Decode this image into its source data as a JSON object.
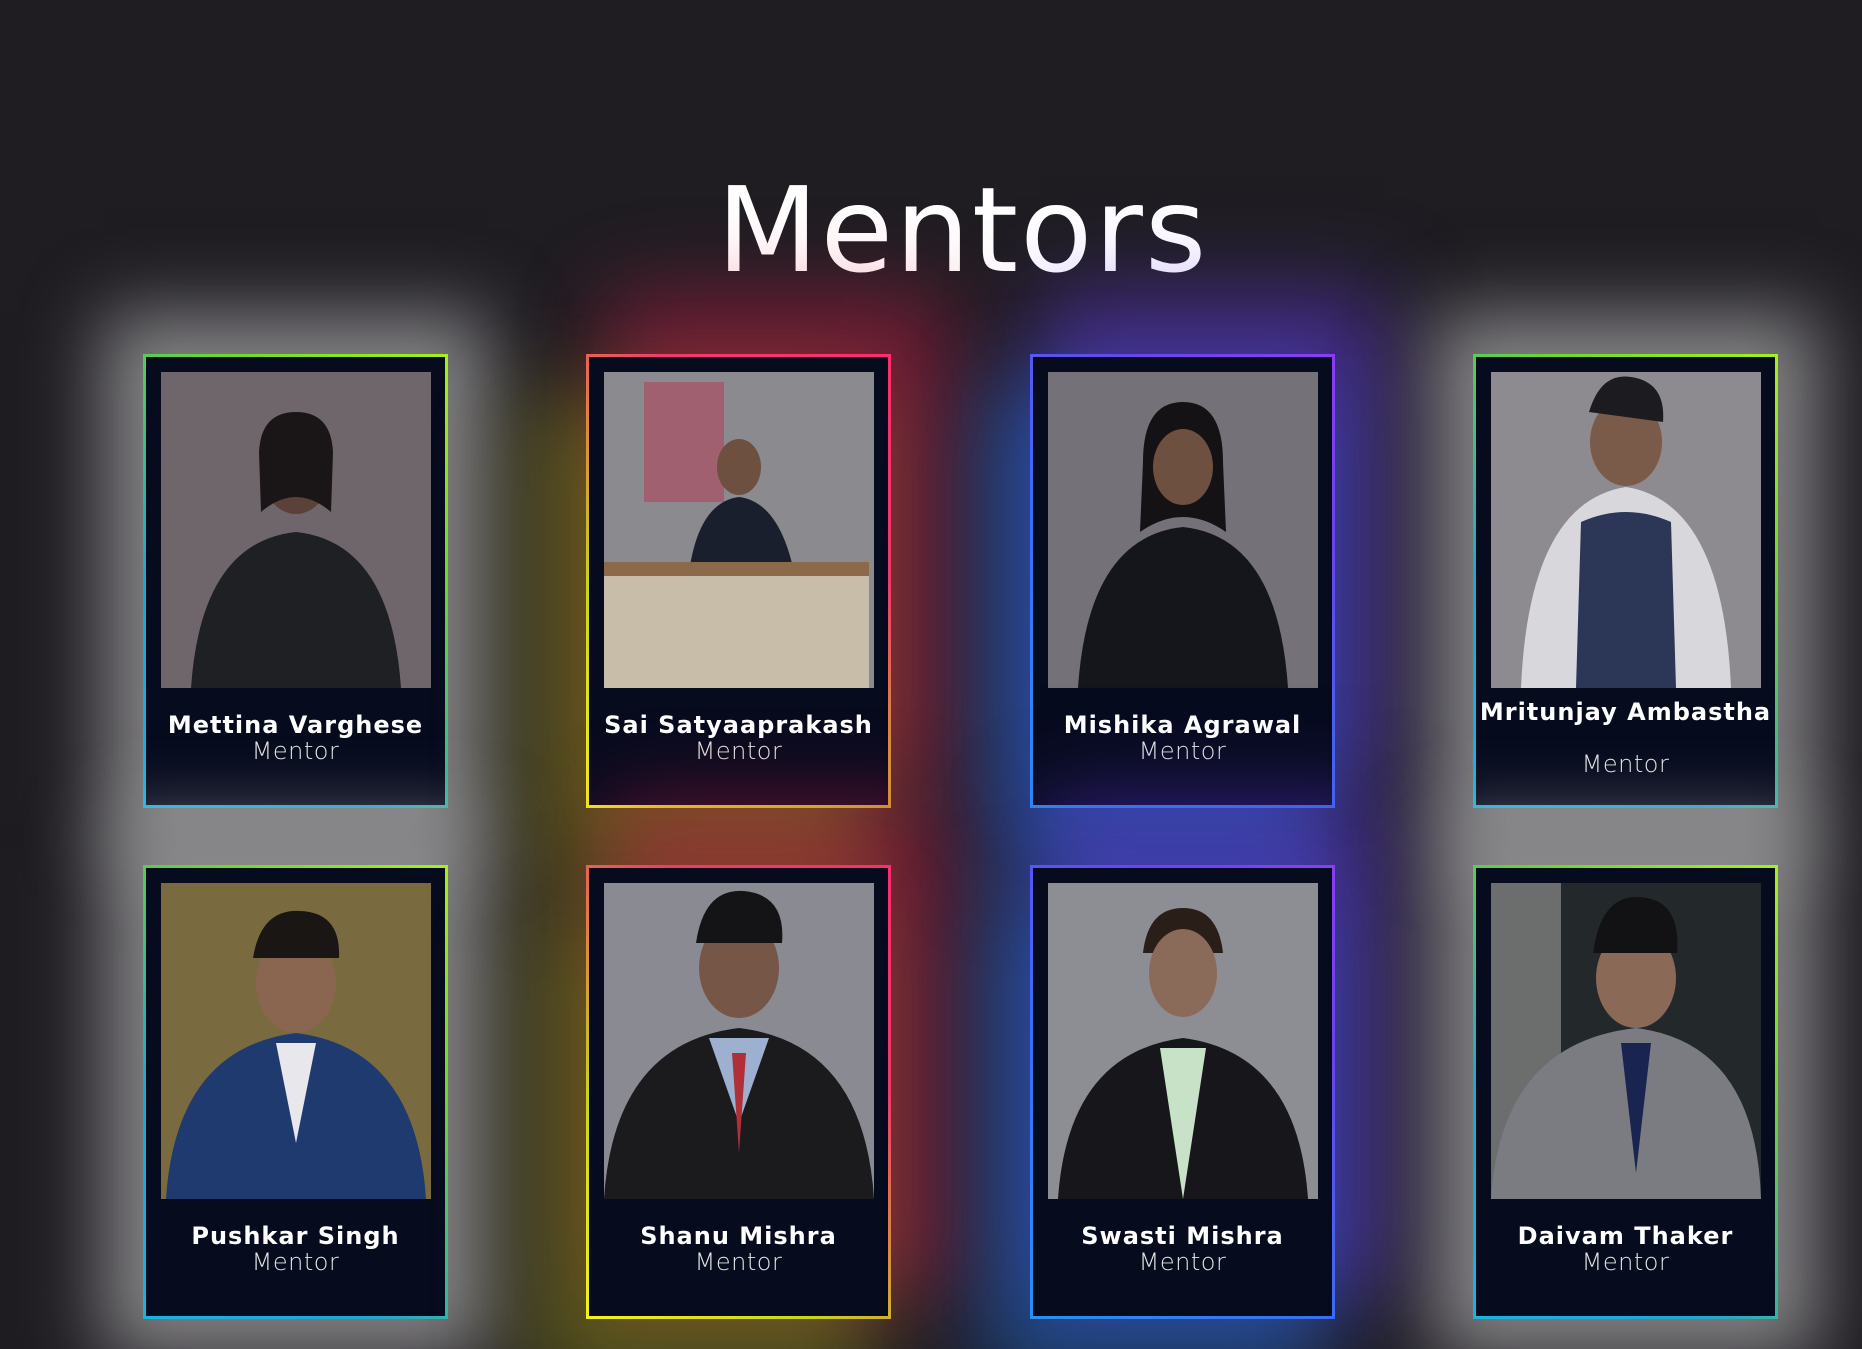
{
  "section": {
    "title": "Mentors"
  },
  "mentors": [
    {
      "name": "Mettina Varghese",
      "role": "Mentor",
      "photo_icon": "portrait-icon"
    },
    {
      "name": "Sai Satyaaprakash",
      "role": "Mentor",
      "photo_icon": "portrait-icon"
    },
    {
      "name": "Mishika Agrawal",
      "role": "Mentor",
      "photo_icon": "portrait-icon"
    },
    {
      "name": "Mritunjay Ambastha",
      "role": "Mentor",
      "photo_icon": "portrait-icon"
    },
    {
      "name": "Pushkar Singh",
      "role": "Mentor",
      "photo_icon": "portrait-icon"
    },
    {
      "name": "Shanu Mishra",
      "role": "Mentor",
      "photo_icon": "portrait-icon"
    },
    {
      "name": "Swasti Mishra",
      "role": "Mentor",
      "photo_icon": "portrait-icon"
    },
    {
      "name": "Daivam Thaker",
      "role": "Mentor",
      "photo_icon": "portrait-icon"
    }
  ],
  "colors": {
    "background": "#1f1d22",
    "card": "#070b1e",
    "accent_green": "#a6f01a",
    "accent_pink": "#ff2c6e",
    "accent_violet": "#8a3df4"
  }
}
